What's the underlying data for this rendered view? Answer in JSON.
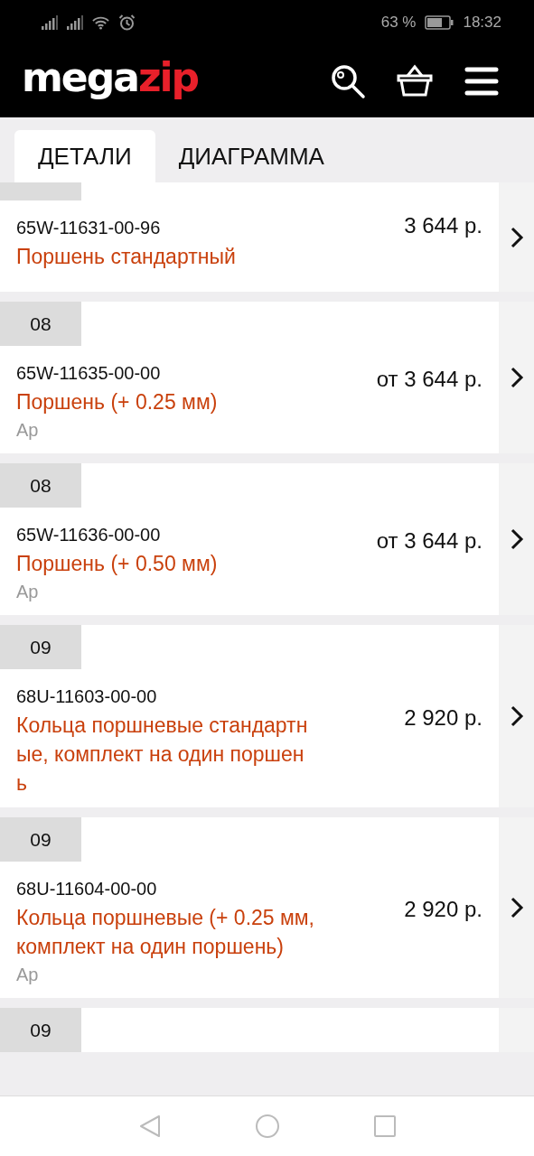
{
  "status_bar": {
    "battery": "63 %",
    "time": "18:32"
  },
  "header": {
    "logo": {
      "first": "mega",
      "second": "zip"
    }
  },
  "tabs": [
    {
      "label": "ДЕТАЛИ",
      "selected": true
    },
    {
      "label": "ДИАГРАММА",
      "selected": false
    }
  ],
  "items": [
    {
      "part_number": "65W-11631-00-96",
      "name": "Поршень стандартный",
      "price": "3 644 р."
    },
    {
      "number": "08",
      "part_number": "65W-11635-00-00",
      "name": "Поршень (+ 0.25 мм)",
      "price": "от 3 644 р.",
      "note": "Ар"
    },
    {
      "number": "08",
      "part_number": "65W-11636-00-00",
      "name": "Поршень (+ 0.50 мм)",
      "price": "от 3 644 р.",
      "note": "Ар"
    },
    {
      "number": "09",
      "part_number": "68U-11603-00-00",
      "name": "Кольца поршневые стандартные, комплект на один поршень",
      "price": "2 920 р."
    },
    {
      "number": "09",
      "part_number": "68U-11604-00-00",
      "name": "Кольца поршневые (+ 0.25 мм, комплект на один поршень)",
      "price": "2 920 р.",
      "note": "Ар"
    },
    {
      "number": "09"
    }
  ]
}
